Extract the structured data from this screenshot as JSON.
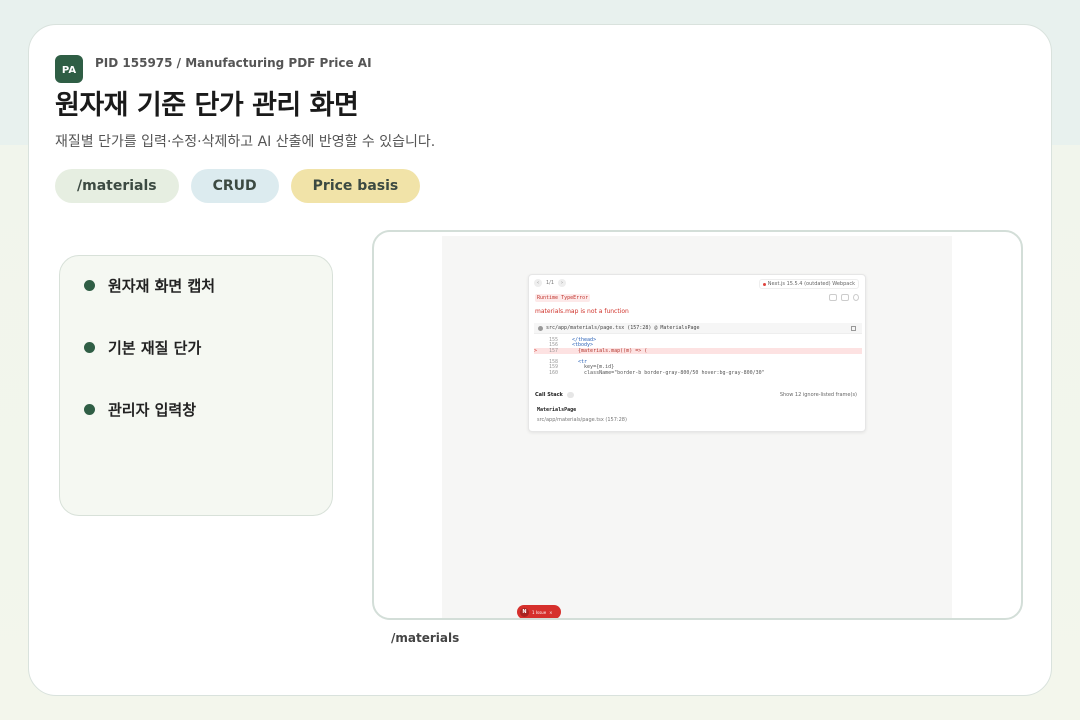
{
  "header": {
    "logo": "PA",
    "pid": "PID 155975 / Manufacturing PDF Price AI",
    "title": "원자재 기준 단가 관리 화면",
    "subtitle": "재질별 단가를 입력·수정·삭제하고 AI 산출에 반영할 수 있습니다."
  },
  "tags": [
    "/materials",
    "CRUD",
    "Price basis"
  ],
  "features": [
    "원자재 화면 캡처",
    "기본 재질 단가",
    "관리자 입력창"
  ],
  "screenshot": {
    "nav_page": "1/1",
    "version": "Next.js 15.5.4 (outdated) Webpack",
    "error_badge": "Runtime TypeError",
    "error_message": "materials.map is not a function",
    "file": "src/app/materials/page.tsx (157:28) @ MaterialsPage",
    "code": [
      {
        "ln": "155",
        "text": "</thead>",
        "style": "blue",
        "marker": ""
      },
      {
        "ln": "156",
        "text": "<tbody>",
        "style": "blue",
        "marker": ""
      },
      {
        "ln": "157",
        "text": "  {materials.map((m) => (",
        "style": "",
        "marker": ">"
      },
      {
        "ln": "",
        "text": "",
        "style": "",
        "marker": ""
      },
      {
        "ln": "158",
        "text": "  <tr",
        "style": "blue",
        "marker": ""
      },
      {
        "ln": "159",
        "text": "    key={m.id}",
        "style": "",
        "marker": ""
      },
      {
        "ln": "160",
        "text": "    className=\"border-b border-gray-800/50 hover:bg-gray-800/30\"",
        "style": "",
        "marker": ""
      }
    ],
    "callstack_label": "Call Stack",
    "callstack_count": "1",
    "show_frames": "Show 12 ignore-listed frame(s)",
    "frame_name": "MaterialsPage",
    "frame_path": "src/app/materials/page.tsx (157:28)",
    "issue_n": "N",
    "issue_label": "1 Issue"
  },
  "caption": "/materials",
  "colors": {
    "brand_green": "#2f5e45",
    "error_red": "#d6302c",
    "tag_materials": "#e6eee1",
    "tag_crud": "#dcebef",
    "tag_price": "#f1e3a8"
  }
}
